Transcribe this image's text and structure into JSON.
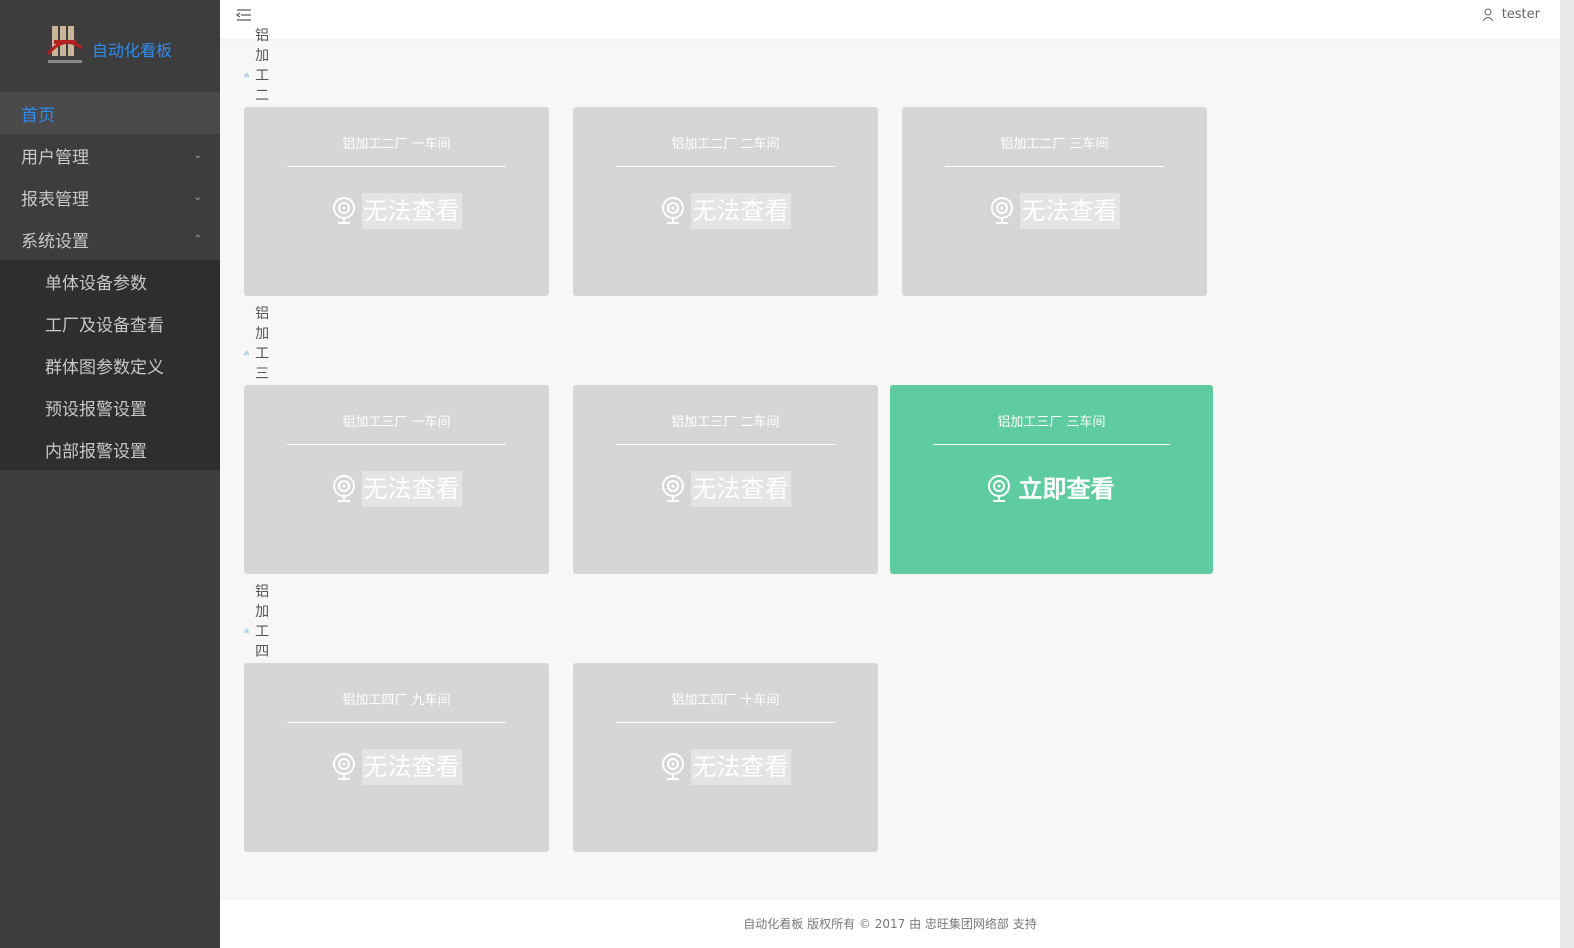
{
  "app": {
    "logo_text": "自动化看板"
  },
  "sidebar": {
    "items": [
      {
        "label": "首页"
      },
      {
        "label": "用户管理"
      },
      {
        "label": "报表管理"
      },
      {
        "label": "系统设置"
      }
    ],
    "submenu": [
      {
        "label": "单体设备参数"
      },
      {
        "label": "工厂及设备查看"
      },
      {
        "label": "群体图参数定义"
      },
      {
        "label": "预设报警设置"
      },
      {
        "label": "内部报警设置"
      }
    ]
  },
  "header": {
    "user": "tester"
  },
  "colors": {
    "accent": "#2d8cf0",
    "live": "#5ecba1",
    "unavailable": "#d6d6d6",
    "sidebar": "#3d3d3d"
  },
  "factories": [
    {
      "name": "铝加工二厂",
      "workshops": [
        {
          "title": "铝加工二厂 一车间",
          "action": "无法查看"
        },
        {
          "title": "铝加工二厂 二车间",
          "action": "无法查看"
        },
        {
          "title": "铝加工二厂 三车间",
          "action": "无法查看"
        }
      ]
    },
    {
      "name": "铝加工三厂",
      "workshops": [
        {
          "title": "铝加工三厂 一车间",
          "action": "无法查看"
        },
        {
          "title": "铝加工三厂 二车间",
          "action": "无法查看"
        },
        {
          "title": "铝加工三厂 三车间",
          "action": "立即查看"
        }
      ]
    },
    {
      "name": "铝加工四厂",
      "workshops": [
        {
          "title": "铝加工四厂 九车间",
          "action": "无法查看"
        },
        {
          "title": "铝加工四厂 十车间",
          "action": "无法查看"
        }
      ]
    }
  ],
  "footer": {
    "text": "自动化看板 版权所有 © 2017 由 忠旺集团网络部 支持"
  }
}
